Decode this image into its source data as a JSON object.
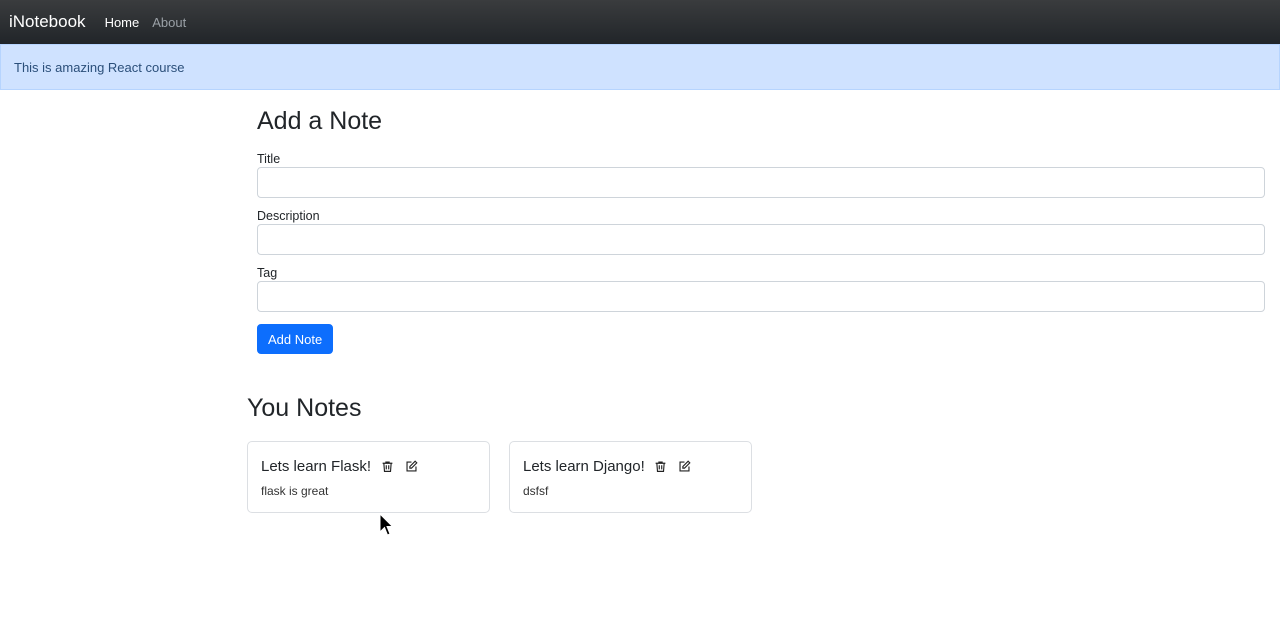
{
  "navbar": {
    "brand": "iNotebook",
    "links": [
      {
        "label": "Home",
        "active": true
      },
      {
        "label": "About",
        "active": false
      }
    ]
  },
  "alert": {
    "message": "This is amazing React course"
  },
  "form": {
    "heading": "Add a Note",
    "fields": [
      {
        "label": "Title",
        "value": ""
      },
      {
        "label": "Description",
        "value": ""
      },
      {
        "label": "Tag",
        "value": ""
      }
    ],
    "submit_label": "Add Note"
  },
  "notes": {
    "heading": "You Notes",
    "items": [
      {
        "title": "Lets learn Flask!",
        "description": "flask is great"
      },
      {
        "title": "Lets learn Django!",
        "description": "dsfsf"
      }
    ]
  },
  "colors": {
    "navbar_bg": "#212529",
    "alert_bg": "#cfe2ff",
    "primary": "#0d6efd"
  },
  "icons": {
    "delete": "trash-icon",
    "edit": "edit-icon"
  }
}
